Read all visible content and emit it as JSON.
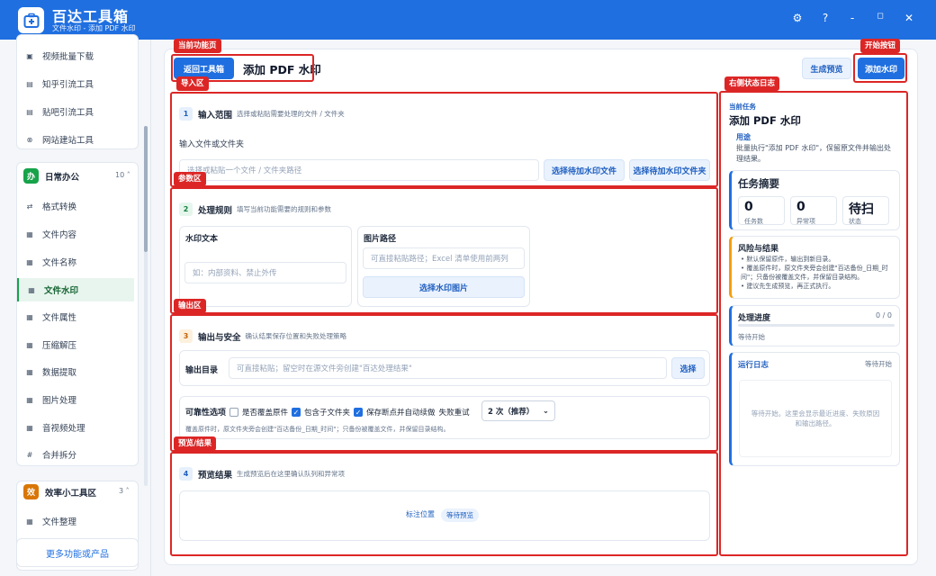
{
  "app": {
    "title": "百达工具箱",
    "subtitle": "文件水印 - 添加 PDF 水印",
    "controls": [
      "⚙",
      "?",
      "-",
      "◻",
      "✕"
    ]
  },
  "sidebar": {
    "top_items": [
      {
        "icon": "▣",
        "label": "视频批量下载"
      },
      {
        "icon": "▤",
        "label": "知乎引流工具"
      },
      {
        "icon": "▤",
        "label": "贴吧引流工具"
      },
      {
        "icon": "⊗",
        "label": "网站建站工具"
      }
    ],
    "group_office": {
      "badge": "办",
      "label": "日常办公",
      "count": "10 ˄"
    },
    "office_items": [
      {
        "icon": "⇄",
        "label": "格式转换"
      },
      {
        "icon": "▦",
        "label": "文件内容"
      },
      {
        "icon": "▦",
        "label": "文件名称"
      },
      {
        "icon": "▦",
        "label": "文件水印"
      },
      {
        "icon": "▦",
        "label": "文件属性"
      },
      {
        "icon": "▦",
        "label": "压缩解压"
      },
      {
        "icon": "▦",
        "label": "数据提取"
      },
      {
        "icon": "▦",
        "label": "图片处理"
      },
      {
        "icon": "▦",
        "label": "音视频处理"
      },
      {
        "icon": "#",
        "label": "合并拆分"
      }
    ],
    "group_tools": {
      "badge": "效",
      "label": "效率小工具区",
      "count": "3 ˄"
    },
    "tools_items": [
      {
        "icon": "▦",
        "label": "文件整理"
      }
    ],
    "more_label": "更多功能或产品"
  },
  "annotations": {
    "current_page": "当前功能页",
    "start_button": "开始按钮",
    "import_area": "导入区",
    "right_log": "右侧状态日志",
    "param_area": "参数区",
    "output_area": "输出区",
    "preview_area": "预览/结果"
  },
  "header": {
    "back_label": "返回工具箱",
    "page_title": "添加 PDF 水印",
    "preview_label": "生成预览",
    "start_label": "添加水印"
  },
  "section1": {
    "num": "1",
    "title": "输入范围",
    "hint": "选择或粘贴需要处理的文件 / 文件夹",
    "field_label": "输入文件或文件夹",
    "placeholder": "选择或粘贴一个文件 / 文件夹路径",
    "pick_file": "选择待加水印文件",
    "pick_folder": "选择待加水印文件夹"
  },
  "section2": {
    "num": "2",
    "title": "处理规则",
    "hint": "填写当前功能需要的规则和参数",
    "wm_text_label": "水印文本",
    "wm_text_placeholder": "如：内部资料、禁止外传",
    "img_path_label": "图片路径",
    "img_path_placeholder": "可直接粘贴路径；Excel 清单使用前两列",
    "pick_img": "选择水印图片"
  },
  "section3": {
    "num": "3",
    "title": "输出与安全",
    "hint": "确认结果保存位置和失败处理策略",
    "out_label": "输出目录",
    "out_placeholder": "可直接粘贴；留空时在源文件旁创建\"百达处理结果\"",
    "choose_label": "选择",
    "options_label": "可靠性选项",
    "opt_overwrite": "是否覆盖原件",
    "opt_subfolders": "包含子文件夹",
    "opt_resume": "保存断点并自动续做",
    "retry_label": "失败重试",
    "retry_value": "2 次（推荐）",
    "note": "覆盖原件时，原文件夹旁会创建\"百达备份_日期_时间\"；只备份被覆盖文件，并保留目录结构。"
  },
  "section4": {
    "num": "4",
    "title": "预览结果",
    "hint": "生成预览后在这里确认队列和异常项",
    "mark_label": "标注位置",
    "status_label": "等待预览"
  },
  "right": {
    "task_label": "当前任务",
    "task_title": "添加 PDF 水印",
    "usage_label": "用途",
    "usage_text": "批量执行\"添加 PDF 水印\"，保留原文件并输出处理结果。",
    "summary_title": "任务摘要",
    "stats": [
      {
        "value": "0",
        "label": "任务数"
      },
      {
        "value": "0",
        "label": "异常项"
      },
      {
        "value": "待扫",
        "label": "状态"
      }
    ],
    "risk_title": "风险与结果",
    "risks": [
      "默认保留原件，输出到新目录。",
      "覆盖原件时，原文件夹旁会创建\"百达备份_日期_时间\"；只备份被覆盖文件，并保留目录结构。",
      "建议先生成预览，再正式执行。"
    ],
    "progress_title": "处理进度",
    "progress_value": "0 / 0",
    "progress": 0,
    "progress_status": "等待开始",
    "log_title": "运行日志",
    "log_status": "等待开始",
    "log_empty": "等待开始。这里会显示最近进度、失败原因和输出路径。"
  },
  "colors": {
    "accent": "#1f6fe0",
    "annotation": "#dc2626",
    "active": "#16a34a"
  }
}
